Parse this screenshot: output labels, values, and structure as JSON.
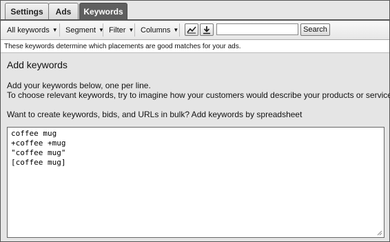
{
  "tabs": [
    {
      "label": "Settings",
      "active": false
    },
    {
      "label": "Ads",
      "active": false
    },
    {
      "label": "Keywords",
      "active": true
    }
  ],
  "toolbar": {
    "all_keywords": "All keywords",
    "segment": "Segment",
    "filter": "Filter",
    "columns": "Columns",
    "chart_icon": "line-chart-icon",
    "download_icon": "download-icon",
    "search_value": "",
    "search_button": "Search"
  },
  "info_text": "These keywords determine which placements are good matches for your ads.",
  "add_keywords": {
    "title": "Add keywords",
    "instruction_1": "Add your keywords below, one per line.",
    "instruction_2": "To choose relevant keywords, try to imagine how your customers would describe your products or services.",
    "bulk_prompt": "Want to create keywords, bids, and URLs in bulk? Add keywords by spreadsheet",
    "keywords": [
      "coffee mug",
      "+coffee +mug",
      "\"coffee mug\"",
      "[coffee mug]"
    ]
  },
  "colors": {
    "active_tab": "#5f5f5f",
    "border": "#555555"
  }
}
